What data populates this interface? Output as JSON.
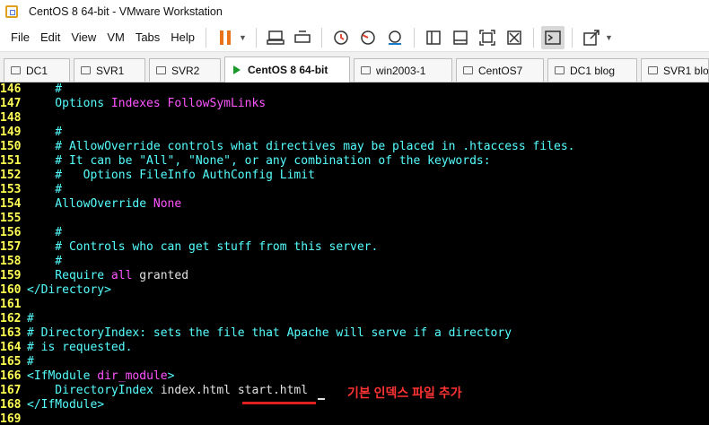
{
  "window": {
    "title": "CentOS 8 64-bit - VMware Workstation"
  },
  "menu": [
    "File",
    "Edit",
    "View",
    "VM",
    "Tabs",
    "Help"
  ],
  "tabs": [
    {
      "label": "DC1",
      "active": false
    },
    {
      "label": "SVR1",
      "active": false
    },
    {
      "label": "SVR2",
      "active": false
    },
    {
      "label": "CentOS 8 64-bit",
      "active": true
    },
    {
      "label": "win2003-1",
      "active": false
    },
    {
      "label": "CentOS7",
      "active": false
    },
    {
      "label": "DC1 blog",
      "active": false
    },
    {
      "label": "SVR1 blog",
      "active": false
    }
  ],
  "terminal": {
    "lines": [
      {
        "n": "146",
        "seg": [
          [
            "    #",
            "cyan"
          ]
        ]
      },
      {
        "n": "147",
        "seg": [
          [
            "    Options ",
            "cyan"
          ],
          [
            "Indexes FollowSymLinks",
            "mag"
          ]
        ]
      },
      {
        "n": "148",
        "seg": []
      },
      {
        "n": "149",
        "seg": [
          [
            "    #",
            "cyan"
          ]
        ]
      },
      {
        "n": "150",
        "seg": [
          [
            "    # AllowOverride controls what directives may be placed in .htaccess files.",
            "cyan"
          ]
        ]
      },
      {
        "n": "151",
        "seg": [
          [
            "    # It can be \"All\", \"None\", or any combination of the keywords:",
            "cyan"
          ]
        ]
      },
      {
        "n": "152",
        "seg": [
          [
            "    #   Options FileInfo AuthConfig Limit",
            "cyan"
          ]
        ]
      },
      {
        "n": "153",
        "seg": [
          [
            "    #",
            "cyan"
          ]
        ]
      },
      {
        "n": "154",
        "seg": [
          [
            "    AllowOverride ",
            "cyan"
          ],
          [
            "None",
            "mag"
          ]
        ]
      },
      {
        "n": "155",
        "seg": []
      },
      {
        "n": "156",
        "seg": [
          [
            "    #",
            "cyan"
          ]
        ]
      },
      {
        "n": "157",
        "seg": [
          [
            "    # Controls who can get stuff from this server.",
            "cyan"
          ]
        ]
      },
      {
        "n": "158",
        "seg": [
          [
            "    #",
            "cyan"
          ]
        ]
      },
      {
        "n": "159",
        "seg": [
          [
            "    Require ",
            "cyan"
          ],
          [
            "all",
            "mag"
          ],
          [
            " granted",
            "white"
          ]
        ]
      },
      {
        "n": "160",
        "seg": [
          [
            "</Directory>",
            "cyan"
          ]
        ]
      },
      {
        "n": "161",
        "seg": []
      },
      {
        "n": "162",
        "seg": [
          [
            "#",
            "cyan"
          ]
        ]
      },
      {
        "n": "163",
        "seg": [
          [
            "# DirectoryIndex: sets the file that Apache will serve if a directory",
            "cyan"
          ]
        ]
      },
      {
        "n": "164",
        "seg": [
          [
            "# is requested.",
            "cyan"
          ]
        ]
      },
      {
        "n": "165",
        "seg": [
          [
            "#",
            "cyan"
          ]
        ]
      },
      {
        "n": "166",
        "seg": [
          [
            "<IfModule ",
            "cyan"
          ],
          [
            "dir_module",
            "mag"
          ],
          [
            ">",
            "cyan"
          ]
        ]
      },
      {
        "n": "167",
        "seg": [
          [
            "    DirectoryIndex ",
            "cyan"
          ],
          [
            "index.html ",
            "white"
          ],
          [
            "start.html",
            "white"
          ]
        ]
      },
      {
        "n": "168",
        "seg": [
          [
            "</IfModule>",
            "cyan"
          ]
        ]
      },
      {
        "n": "169",
        "seg": []
      }
    ],
    "annotation": "기본 인덱스 파일 추가"
  }
}
